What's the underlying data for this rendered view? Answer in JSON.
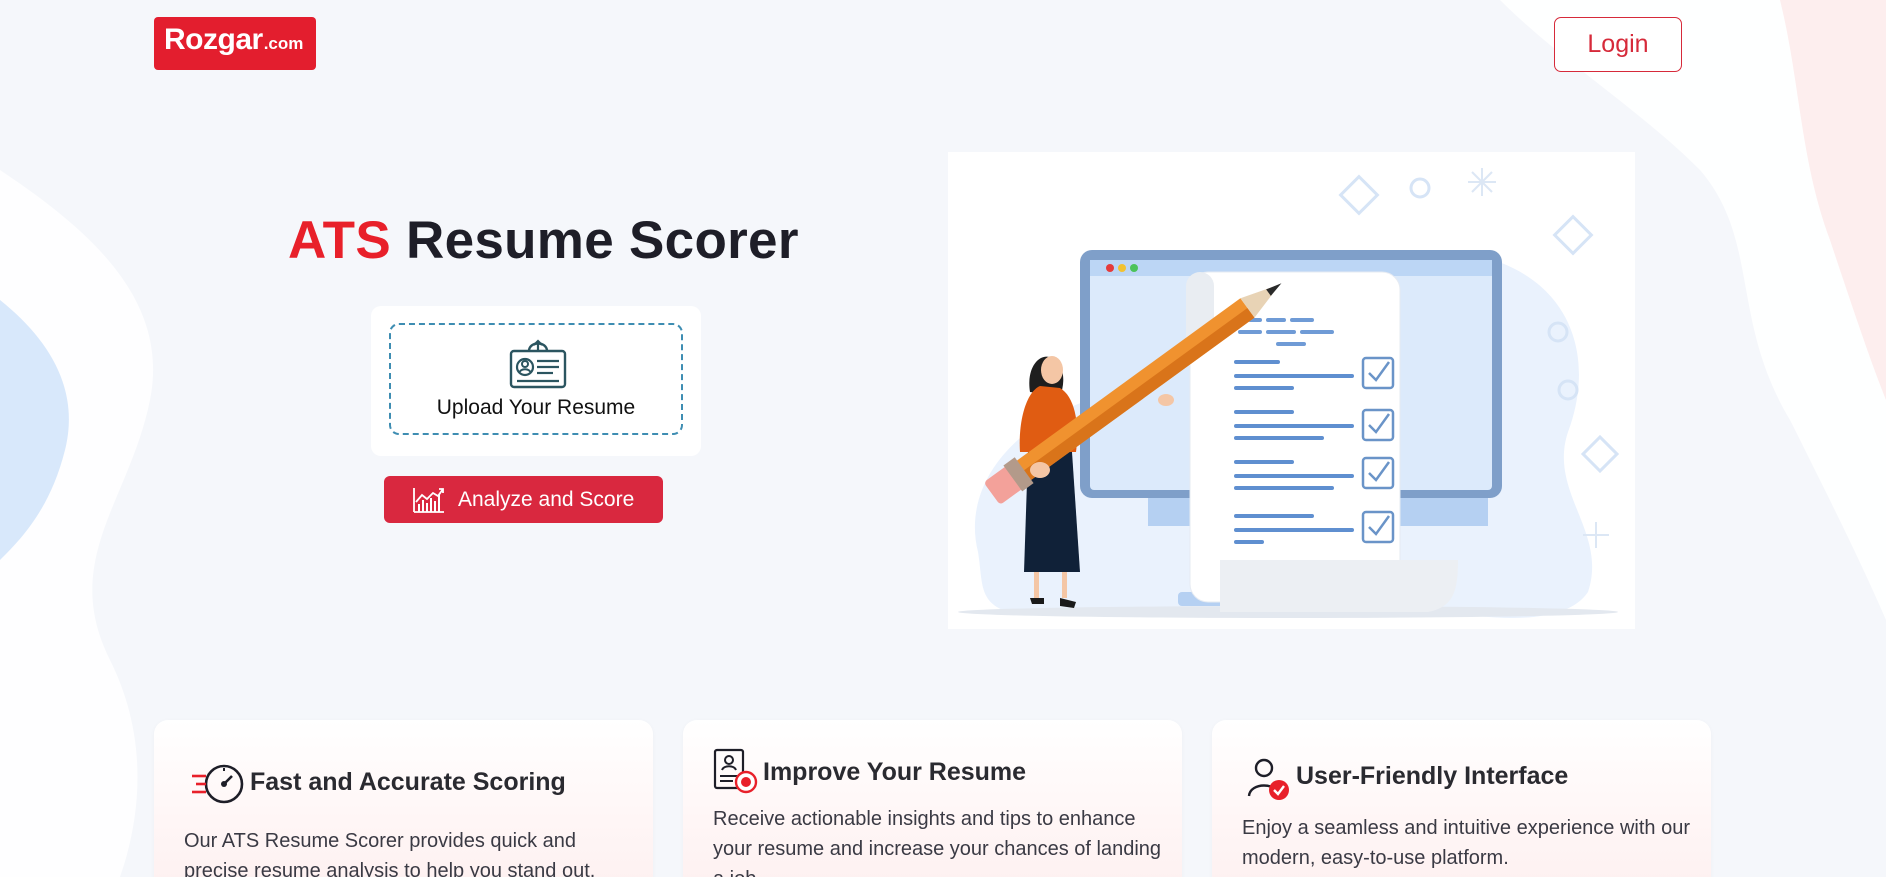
{
  "header": {
    "logo_brand": "Rozgar",
    "logo_tld": ".com",
    "login_label": "Login"
  },
  "hero": {
    "title_accent": "ATS",
    "title_rest": " Resume Scorer",
    "upload_label": "Upload Your Resume",
    "analyze_label": "Analyze and Score"
  },
  "features": [
    {
      "title": "Fast and Accurate Scoring",
      "description": "Our ATS Resume Scorer provides quick and precise resume analysis to help you stand out.",
      "icon": "speedometer-icon"
    },
    {
      "title": "Improve Your Resume",
      "description": "Receive actionable insights and tips to enhance your resume and increase your chances of landing a job.",
      "icon": "resume-badge-icon"
    },
    {
      "title": "User-Friendly Interface",
      "description": "Enjoy a seamless and intuitive experience with our modern, easy-to-use platform.",
      "icon": "user-check-icon"
    }
  ],
  "colors": {
    "brand_red": "#e31e2e",
    "button_red": "#d9283f",
    "background": "#f5f7fb"
  }
}
